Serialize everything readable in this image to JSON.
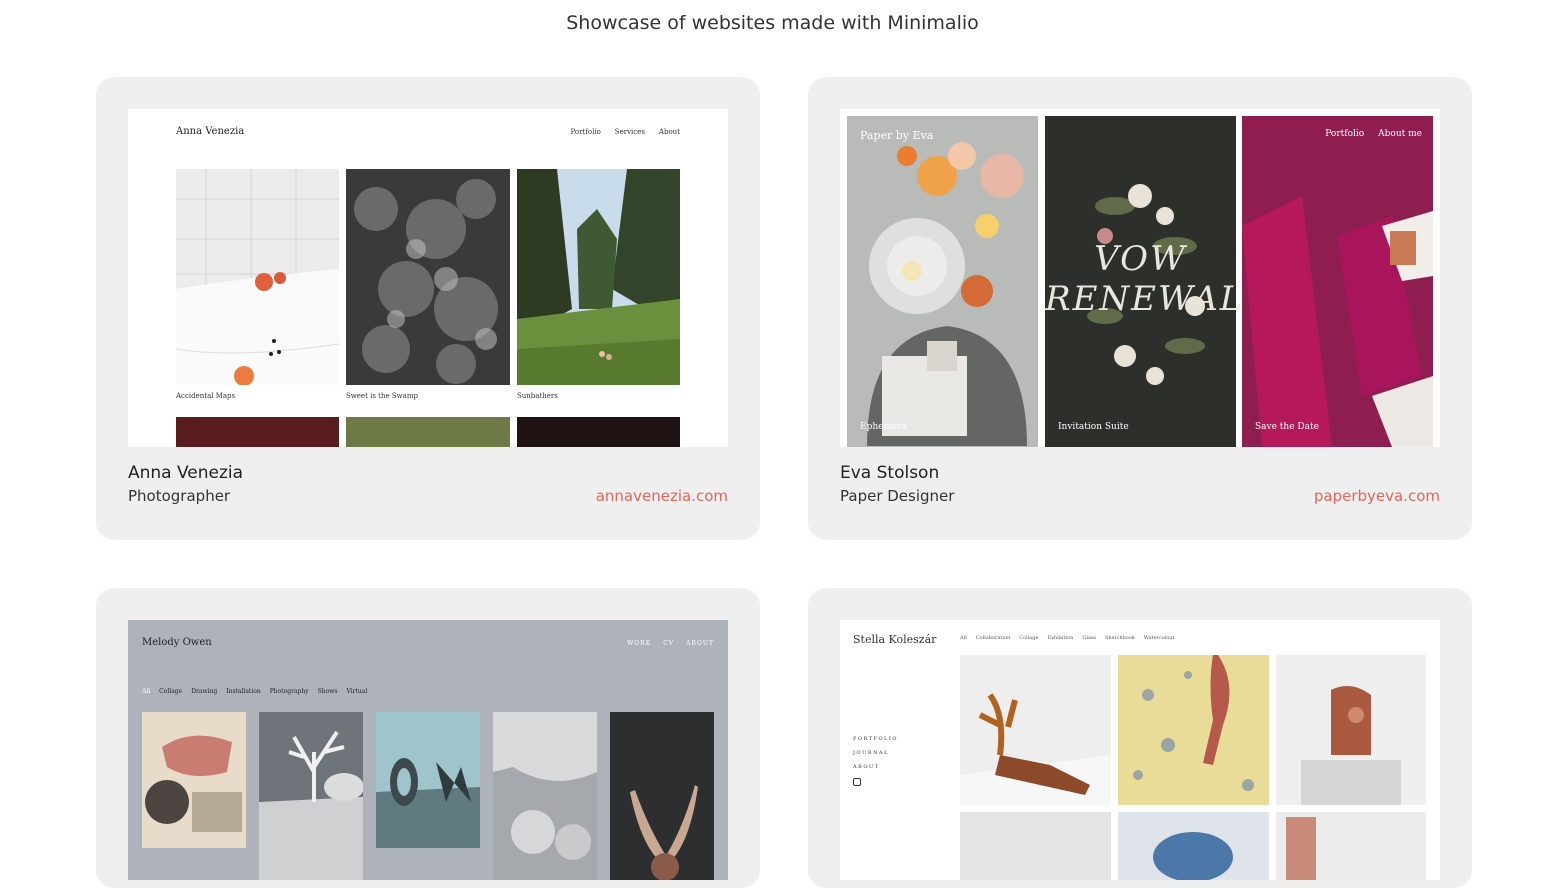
{
  "page": {
    "title": "Showcase of websites made with Minimalio"
  },
  "cards": [
    {
      "name": "Anna Venezia",
      "role": "Photographer",
      "link": "annavenezia.com",
      "site": {
        "brand": "Anna Venezia",
        "nav": [
          "Portfolio",
          "Services",
          "About"
        ],
        "captions": [
          "Accidental Maps",
          "Sweet is the Swamp",
          "Sunbathers"
        ]
      }
    },
    {
      "name": "Eva Stolson",
      "role": "Paper Designer",
      "link": "paperbyeva.com",
      "site": {
        "brand": "Paper by Eva",
        "nav": [
          "Portfolio",
          "About me"
        ],
        "panels": [
          "Ephemera",
          "Invitation Suite",
          "Save the Date"
        ],
        "art_text": [
          "VOW",
          "RENEWAL"
        ]
      }
    },
    {
      "name": "Melody Owen",
      "role": "",
      "link": "",
      "site": {
        "brand": "Melody Owen",
        "nav": [
          "WORK",
          "CV",
          "ABOUT"
        ],
        "filters": [
          "All",
          "Collage",
          "Drawing",
          "Installation",
          "Photography",
          "Shows",
          "Virtual"
        ]
      }
    },
    {
      "name": "Stella Koleszár",
      "role": "",
      "link": "",
      "site": {
        "brand": "Stella Koleszár",
        "filters": [
          "All",
          "Collaboration",
          "Collage",
          "Exhibition",
          "Glass",
          "Sketchbook",
          "Watercolour"
        ],
        "side_nav": [
          "PORTFOLIO",
          "JOURNAL",
          "ABOUT"
        ]
      }
    }
  ],
  "colors": {
    "card_bg": "#efefef",
    "link": "#e0675a",
    "melody_bg": "#aeb2ba"
  }
}
